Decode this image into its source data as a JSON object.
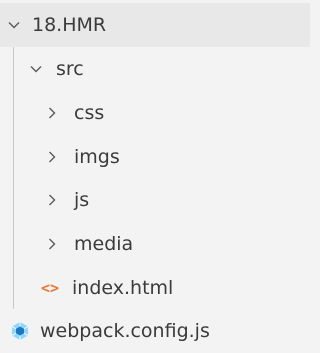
{
  "tree": {
    "root": {
      "label": "18.HMR",
      "icon": "chevron-down-icon"
    },
    "src": {
      "label": "src",
      "icon": "chevron-down-icon"
    },
    "children": [
      {
        "label": "css",
        "icon": "chevron-right-icon"
      },
      {
        "label": "imgs",
        "icon": "chevron-right-icon"
      },
      {
        "label": "js",
        "icon": "chevron-right-icon"
      },
      {
        "label": "media",
        "icon": "chevron-right-icon"
      }
    ],
    "index_file": {
      "label": "index.html",
      "icon": "html-file-icon"
    },
    "webpack_file": {
      "label": "webpack.config.js",
      "icon": "webpack-icon"
    }
  },
  "colors": {
    "background": "#f3f3f3",
    "selected_row": "#e8e8e8",
    "text": "#3b3b3b",
    "html_icon": "#e37933",
    "webpack_icon": "#5ba4d6"
  }
}
